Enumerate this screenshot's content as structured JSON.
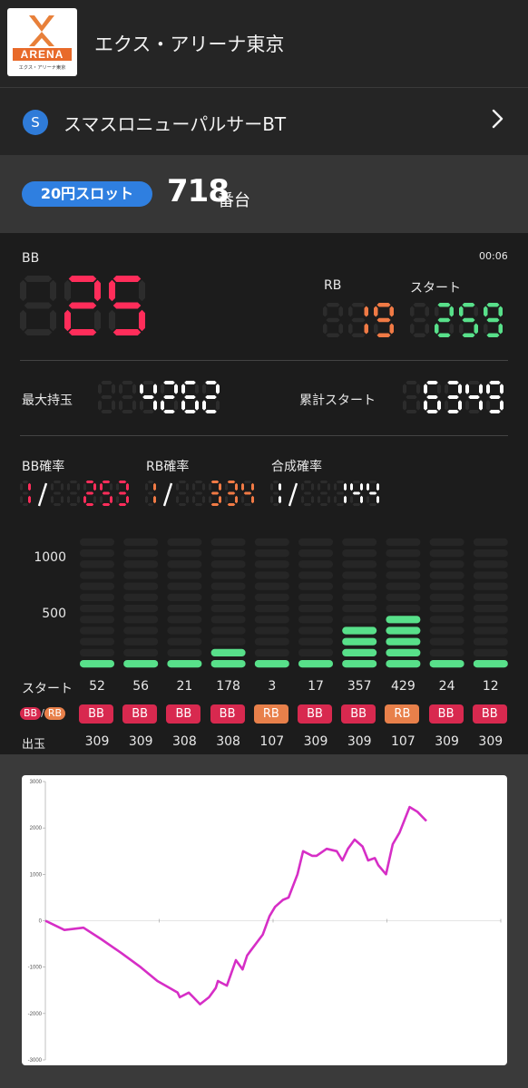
{
  "header": {
    "logo_text": "ARENA",
    "logo_sub": "エクス・アリーナ東京",
    "shop_name": "エクス・アリーナ東京"
  },
  "machine": {
    "icon_letter": "S",
    "name": "スマスロニューパルサーBT"
  },
  "unit": {
    "rate_label": "20円スロット",
    "number": "718",
    "suffix": "番台"
  },
  "counters": {
    "bb_label": "BB",
    "time": "00:06",
    "bb": "25",
    "rb_label": "RB",
    "rb": "19",
    "start_label": "スタート",
    "start": "259",
    "max_label": "最大持玉",
    "max": "4262",
    "total_label": "累計スタート",
    "total": "6349"
  },
  "probabilities": {
    "bb_label": "BB確率",
    "bb_value": "253",
    "rb_label": "RB確率",
    "rb_value": "334",
    "combined_label": "合成確率",
    "combined_value": "144",
    "prefix": "1/"
  },
  "history": {
    "y_labels": [
      "1000",
      "500"
    ],
    "start_row_label": "スタート",
    "type_row_label": [
      "BB",
      "/",
      "RB"
    ],
    "payout_row_label": "出玉",
    "starts": [
      52,
      56,
      21,
      178,
      3,
      17,
      357,
      429,
      24,
      12
    ],
    "start_text": [
      "52",
      "56",
      "21",
      "178",
      "3",
      "17",
      "357",
      "429",
      "24",
      "12"
    ],
    "types": [
      "BB",
      "BB",
      "BB",
      "BB",
      "RB",
      "BB",
      "BB",
      "RB",
      "BB",
      "BB"
    ],
    "payouts": [
      "309",
      "309",
      "308",
      "308",
      "107",
      "309",
      "309",
      "107",
      "309",
      "309"
    ]
  },
  "colors": {
    "bb": "#ff2d5a",
    "rb": "#f07a45",
    "start": "#58e08a",
    "badge_bb": "#d8294f",
    "badge_rb": "#e8804a",
    "line": "#d62ec6"
  },
  "chart_data": {
    "type": "line",
    "ylim": [
      -3000,
      3000
    ],
    "y_ticks": [
      "3000",
      "2000",
      "1000",
      "0",
      "-1000",
      "-2000",
      "-3000"
    ],
    "x": [
      0,
      170,
      340,
      500,
      680,
      850,
      1000,
      1110,
      1180,
      1200,
      1280,
      1320,
      1380,
      1460,
      1520,
      1540,
      1620,
      1700,
      1760,
      1800,
      1830,
      1940,
      2000,
      2050,
      2120,
      2170,
      2250,
      2300,
      2380,
      2420,
      2510,
      2600,
      2650,
      2700,
      2760,
      2830,
      2880,
      2940,
      2970,
      3040,
      3100,
      3160,
      3250,
      3320,
      3400
    ],
    "y": [
      0,
      -200,
      -150,
      -400,
      -700,
      -1000,
      -1300,
      -1450,
      -1550,
      -1650,
      -1550,
      -1650,
      -1800,
      -1650,
      -1450,
      -1300,
      -1400,
      -850,
      -1050,
      -750,
      -650,
      -300,
      100,
      300,
      450,
      500,
      1000,
      1500,
      1400,
      1400,
      1550,
      1500,
      1300,
      1550,
      1750,
      1600,
      1300,
      1350,
      1200,
      1000,
      1650,
      1900,
      2450,
      2350,
      2150
    ]
  }
}
